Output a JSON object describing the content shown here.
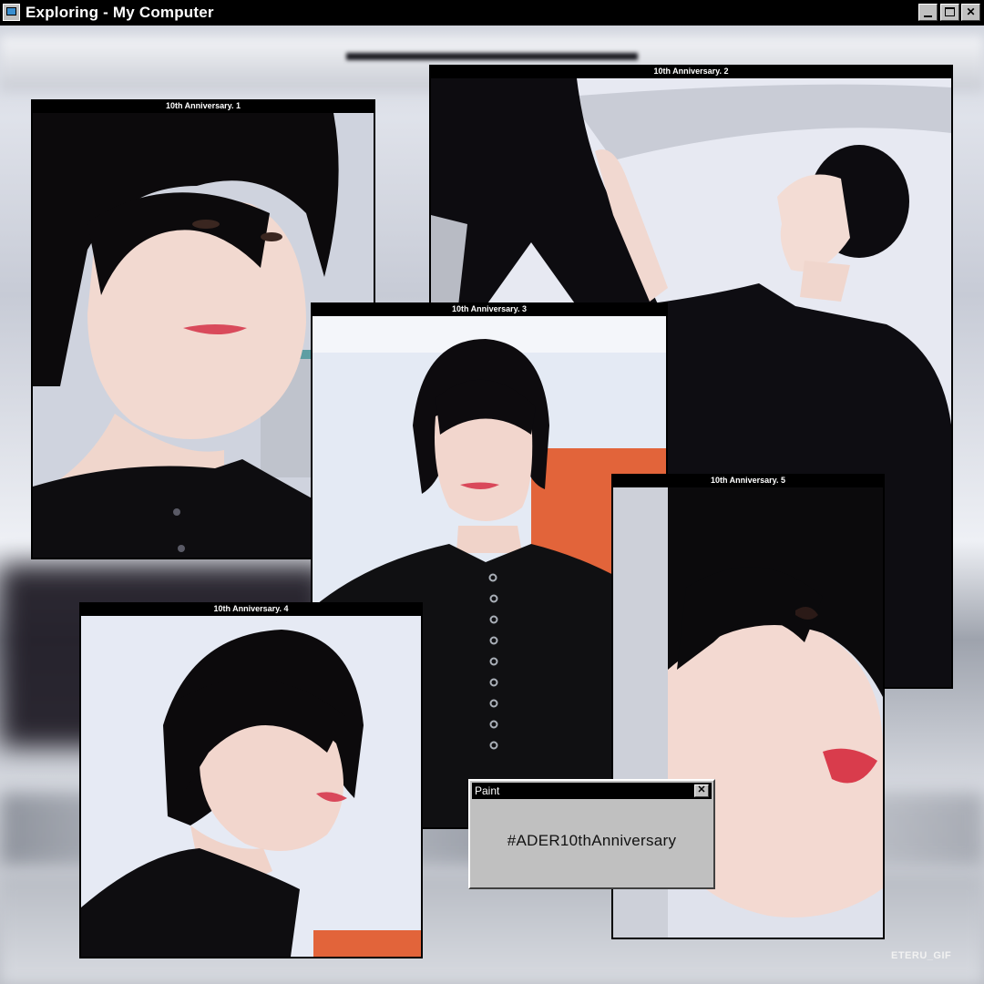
{
  "window": {
    "title": "Exploring - My Computer",
    "minimize_label": "",
    "maximize_label": "",
    "close_label": "✕"
  },
  "photos": [
    {
      "caption": "10th Anniversary. 1"
    },
    {
      "caption": "10th Anniversary. 2"
    },
    {
      "caption": "10th Anniversary. 3"
    },
    {
      "caption": "10th Anniversary. 4"
    },
    {
      "caption": "10th Anniversary. 5"
    }
  ],
  "paint_dialog": {
    "title": "Paint",
    "close_label": "✕",
    "text": "#ADER10thAnniversary"
  },
  "watermark": "ETERU_GIF",
  "colors": {
    "titlebar": "#000000",
    "frame": "#000000",
    "dialog_face": "#c0c0c0",
    "caption_text": "#ffffff"
  }
}
